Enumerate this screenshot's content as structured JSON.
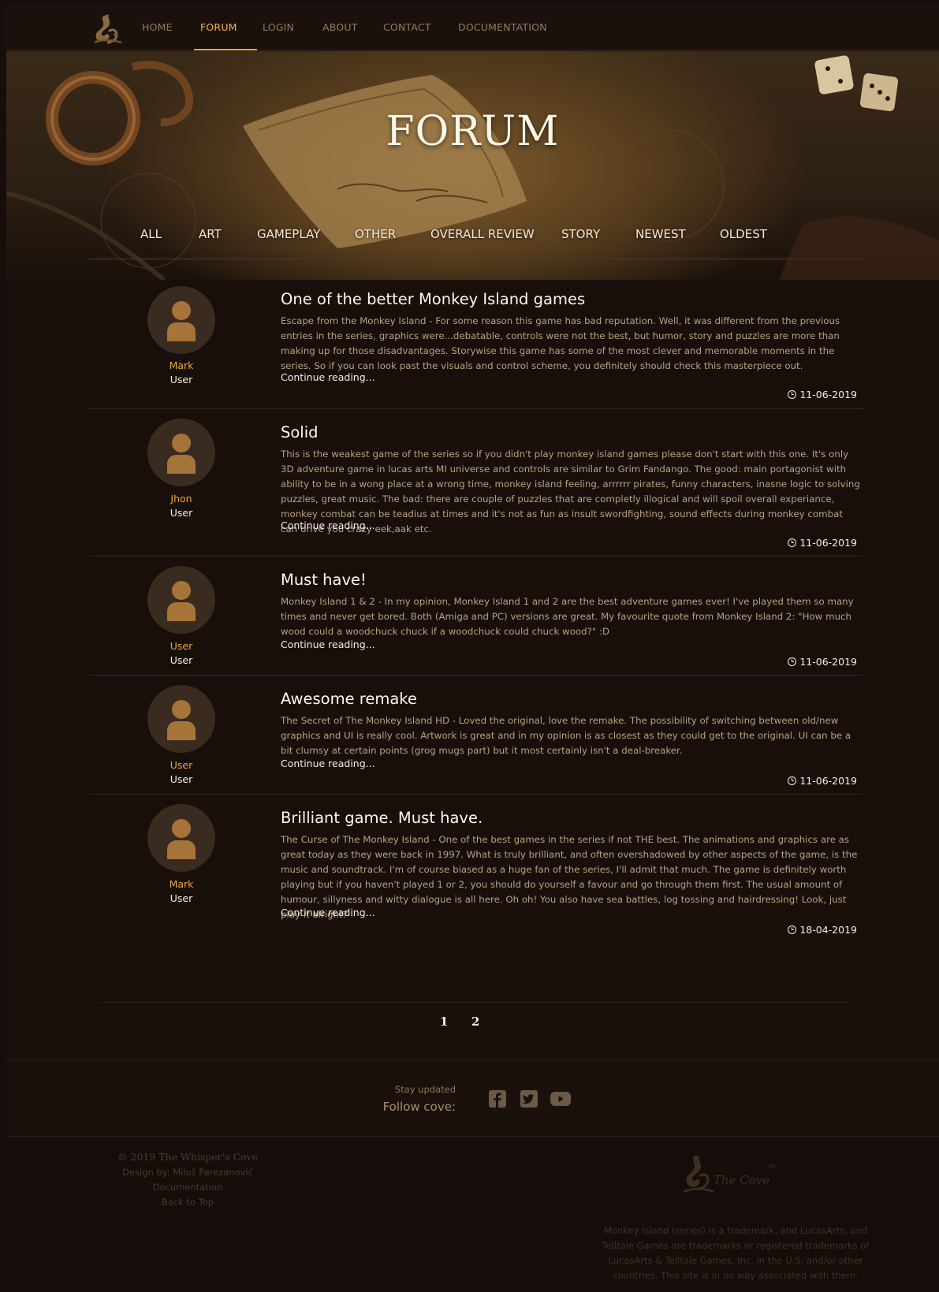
{
  "nav": {
    "items": [
      "HOME",
      "FORUM",
      "LOGIN",
      "ABOUT",
      "CONTACT",
      "DOCUMENTATION"
    ],
    "active": "FORUM"
  },
  "hero": {
    "title": "FORUM",
    "categories": [
      "ALL",
      "ART",
      "GAMEPLAY",
      "OTHER",
      "OVERALL REVIEW",
      "STORY",
      "NEWEST",
      "OLDEST"
    ]
  },
  "posts": [
    {
      "author": "Mark",
      "role": "User",
      "title": "One of the better Monkey Island games",
      "body": "Escape from the Monkey Island - For some reason this game has bad reputation. Well, it was different from the previous entries in the series, graphics were...debatable, controls were not the best, but humor, story and puzzles are more than making up for those disadvantages. Storywise this game has some of the most clever and memorable moments in the series. So if you can look past the visuals and control scheme, you definitely should check this masterpiece out.",
      "more": "Continue reading...",
      "date": "11-06-2019"
    },
    {
      "author": "Jhon",
      "role": "User",
      "title": "Solid",
      "body": "This is the weakest game of the series so if you didn't play monkey island games please don't start with this one. It's only 3D adventure game in lucas arts MI universe and controls are similar to Grim Fandango. The good: main portagonist with ability to be in a wong place at a wrong time, monkey island feeling, arrrrrr pirates, funny characters, inasne logic to solving puzzles, great music. The bad: there are couple of puzzles that are completly illogical and will spoil overall experiance, monkey combat can be teadius at times and it's not as fun as insult swordfighting, sound effects during monkey combat can drive you crazy eek,aak etc.",
      "more": "Continue reading...",
      "date": "11-06-2019"
    },
    {
      "author": "User",
      "role": "User",
      "title": "Must have!",
      "body": "Monkey Island 1 & 2 - In my opinion, Monkey Island 1 and 2 are the best adventure games ever! I've played them so many times and never get bored. Both (Amiga and PC) versions are great. My favourite quote from Monkey Island 2: \"How much wood could a woodchuck chuck if a woodchuck could chuck wood?\" :D",
      "more": "Continue reading...",
      "date": "11-06-2019"
    },
    {
      "author": "User",
      "role": "User",
      "title": "Awesome remake",
      "body": "The Secret of The Monkey Island HD - Loved the original, love the remake. The possibility of switching between old/new graphics and UI is really cool. Artwork is great and in my opinion is as closest as they could get to the original. UI can be a bit clumsy at certain points (grog mugs part) but it most certainly isn't a deal-breaker.",
      "more": "Continue reading...",
      "date": "11-06-2019"
    },
    {
      "author": "Mark",
      "role": "User",
      "title": "Brilliant game. Must have.",
      "body": "The Curse of The Monkey Island - One of the best games in the series if not THE best. The animations and graphics are as great today as they were back in 1997. What is truly brilliant, and often overshadowed by other aspects of the game, is the music and soundtrack. I'm of course biased as a huge fan of the series, I'll admit that much. The game is definitely worth playing but if you haven't played 1 or 2, you should do yourself a favour and go through them first. The usual amount of humour, sillyness and witty dialogue is all here. Oh oh! You also have sea battles, log tossing and hairdressing! Look, just play it alright?",
      "more": "Continue reading...",
      "date": "18-04-2019"
    }
  ],
  "pagination": [
    "1",
    "2"
  ],
  "social": {
    "stay": "Stay updated",
    "follow": "Follow cove:",
    "icons": [
      "facebook-icon",
      "twitter-icon",
      "youtube-icon"
    ]
  },
  "footer": {
    "copyright": "© 2019 The Whisper's Cove",
    "design": "Design by: Miloš Parezanović",
    "documentation": "Documentation",
    "back_to_top": "Back to Top",
    "logo_text": "The Cove",
    "logo_tm": "TM",
    "legal": "Monkey Island (series) is a trademark, and LucasArts, and Telltale Games are trademarks or registered trademarks of LucasArts & Telltale Games, Inc. in the U.S. and/or other countries. This site is in no way associated with them."
  },
  "colors": {
    "background": "#180f0b",
    "accent": "#f0b23c",
    "author": "#e7a63a",
    "avatar_figure": "#a67338"
  }
}
